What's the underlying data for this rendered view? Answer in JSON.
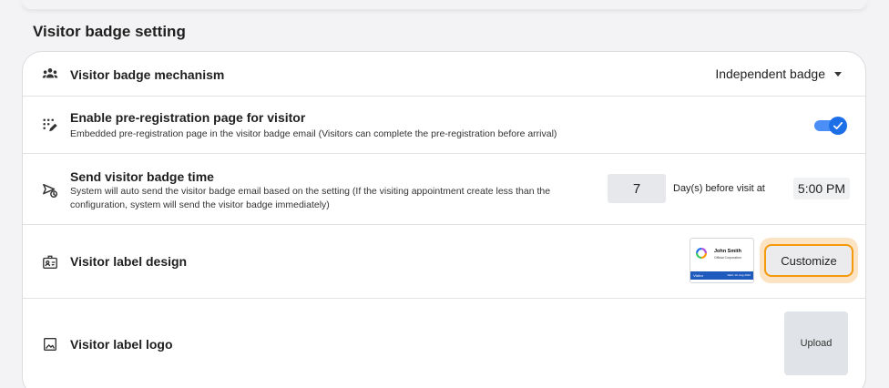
{
  "section": {
    "title": "Visitor badge setting"
  },
  "mechanism": {
    "label": "Visitor badge mechanism",
    "selected": "Independent badge",
    "icon": "users-icon"
  },
  "preregistration": {
    "label": "Enable pre-registration page for visitor",
    "description": "Embedded pre-registration page in the visitor badge email (Visitors can complete the pre-registration before arrival)",
    "enabled": true,
    "icon": "dots-pencil-icon"
  },
  "send_time": {
    "label": "Send visitor badge time",
    "description_line1": "System will auto send the visitor badge email based on the setting (If the visiting appointment create less than the",
    "description_line2": "configuration, system will send the visitor badge immediately)",
    "days": "7",
    "days_text": "Day(s) before visit at",
    "time": "5:00 PM",
    "icon": "send-clock-icon"
  },
  "label_design": {
    "label": "Visitor label design",
    "button": "Customize",
    "preview": {
      "name": "John Smith",
      "company": "Official Corporation",
      "tag": "Visitor",
      "valid": "Valid: 10. Aug 2022"
    },
    "icon": "id-card-icon"
  },
  "label_logo": {
    "label": "Visitor label logo",
    "button": "Upload",
    "icon": "image-icon"
  },
  "colors": {
    "accent": "#1d6fe8",
    "highlight_border": "#f59a0a",
    "highlight_bg": "#fbe3c3"
  }
}
